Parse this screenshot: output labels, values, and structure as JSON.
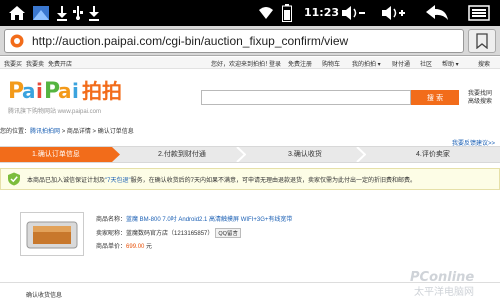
{
  "status_bar": {
    "time": "11:23",
    "left_icons": [
      "home-icon",
      "gallery-icon",
      "usb-icon",
      "download-icon"
    ],
    "right_icons": [
      "wifi-icon",
      "battery-icon",
      "volume-down-icon",
      "volume-up-icon",
      "back-icon",
      "menu-icon"
    ]
  },
  "browser": {
    "url": "http://auction.paipai.com/cgi-bin/auction_fixup_confirm/view"
  },
  "top_links": {
    "left": [
      "我要买",
      "我要卖",
      "免费开店"
    ],
    "right": [
      "您好，欢迎来到拍拍！",
      "登录",
      "免费注册",
      "购物车",
      "我的拍拍 ▾",
      "财付通",
      "社区",
      "帮助 ▾",
      "搜索"
    ]
  },
  "logo": {
    "text": "PaiPai拍拍",
    "subtitle": "腾讯旗下购物网站 www.paipai.com"
  },
  "search": {
    "button": "搜 索",
    "advanced_line1": "我要找同",
    "advanced_line2": "高级搜索"
  },
  "breadcrumb": {
    "prefix": "您的位置：",
    "link": "腾讯拍拍网",
    "rest": " > 商品详情 > 确认订单信息"
  },
  "feedback": "我要反馈建议>>",
  "steps": [
    "1.确认订单信息",
    "2.付款到财付通",
    "3.确认收货",
    "4.评价卖家"
  ],
  "info": {
    "before": "本商品已加入诚信保证计划及",
    "link": "\"7天包退\"",
    "after": "服务，在确认收货后的7天内如果不满意，可申请无理由退款退货，卖家仅需为此付出一定的折旧费和邮费。"
  },
  "product": {
    "name_label": "商品名称：",
    "name": "蓝魔 BM-800 7.0吋 Android2.1 高清触摸屏 WIFI+3G+有线宽带",
    "seller_label": "卖家昵称：",
    "seller": "蓝魔数码官方店（1213165857）",
    "qq_label": "QQ留言",
    "price_label": "商品单价：",
    "price": "699.00",
    "price_unit": "元"
  },
  "confirm_section": "确认收货信息",
  "watermark": {
    "brand": "PConline",
    "subtitle": "太平洋电脑网"
  },
  "colors": {
    "accent": "#f26c1a",
    "link": "#1a5fb4",
    "price": "#e8520a"
  }
}
